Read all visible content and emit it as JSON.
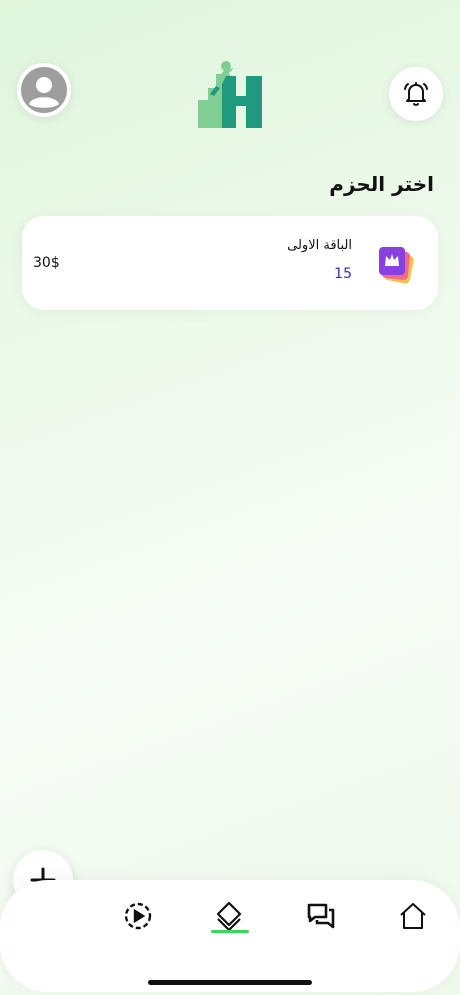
{
  "header": {
    "avatar_icon": "user-avatar-icon",
    "logo_icon": "building-climber-logo",
    "notification_icon": "bell-icon"
  },
  "page": {
    "title": "اختر الحزم"
  },
  "packages": [
    {
      "name": "الباقة الاولى",
      "count": "15",
      "price": "30$",
      "icon": "crown-cards-icon"
    }
  ],
  "fab": {
    "icon": "plus-icon"
  },
  "bottom_nav": {
    "items": [
      {
        "id": "video",
        "icon": "play-circle-icon",
        "active": false
      },
      {
        "id": "packages",
        "icon": "layers-icon",
        "active": true
      },
      {
        "id": "chat",
        "icon": "chat-bubbles-icon",
        "active": false
      },
      {
        "id": "home",
        "icon": "home-icon",
        "active": false
      }
    ],
    "active_color": "#3cd65a"
  },
  "colors": {
    "accent": "#3cd65a",
    "count_text": "#3a2db3",
    "logo_dark": "#1f9a7f",
    "logo_light": "#7fcf95"
  }
}
